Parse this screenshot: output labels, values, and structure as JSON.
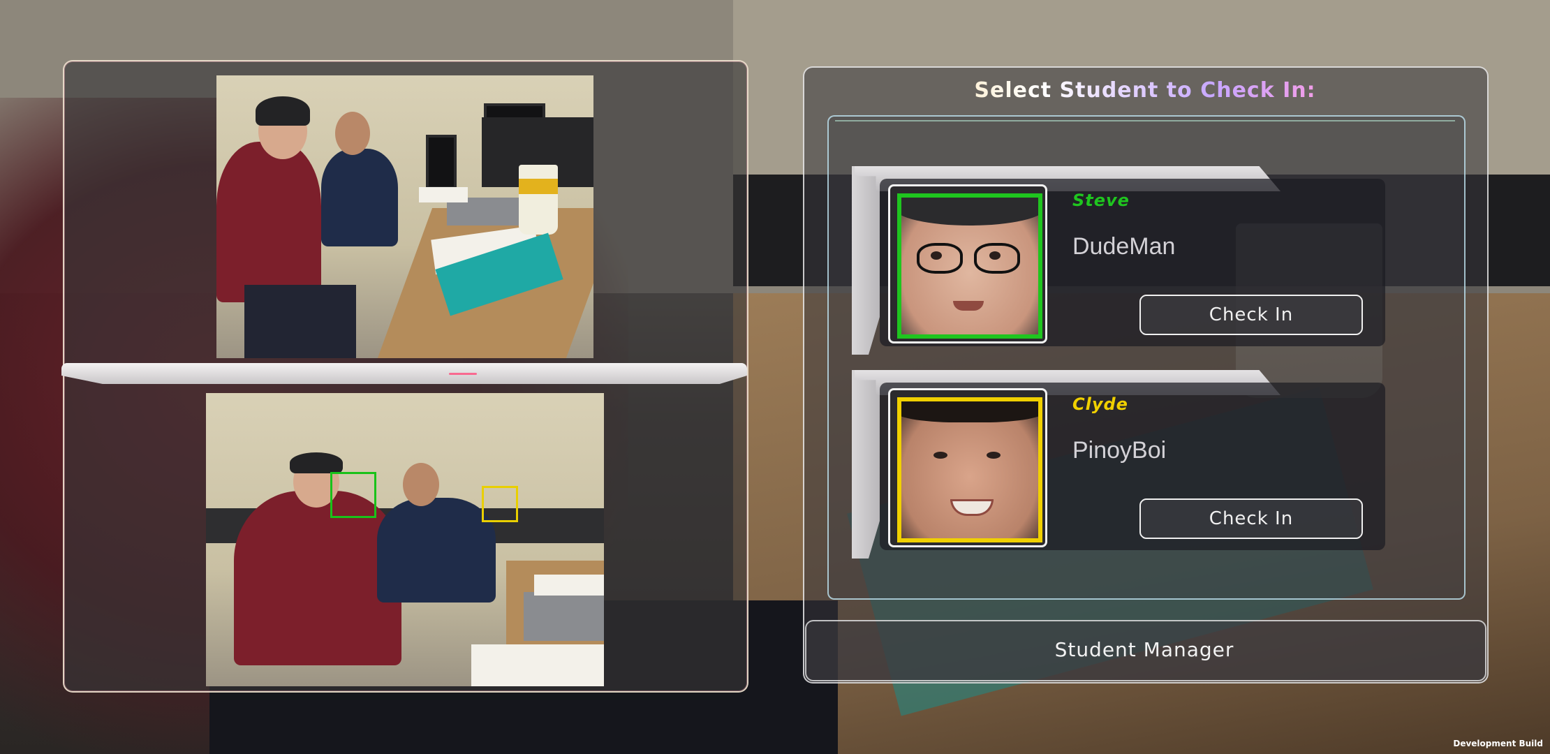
{
  "header": {
    "title": "Select Student to Check In:"
  },
  "students": [
    {
      "name": "Steve",
      "nickname": "DudeMan",
      "button_label": "Check In",
      "accent": "#1fc51f",
      "face_icon": "face-thumbnail"
    },
    {
      "name": "Clyde",
      "nickname": "PinoyBoi",
      "button_label": "Check In",
      "accent": "#f0d000",
      "face_icon": "face-thumbnail"
    }
  ],
  "footer": {
    "label": "Student Manager"
  },
  "build_label": "Development Build",
  "colors": {
    "steve_box": "#1fc51f",
    "clyde_box": "#f0d000",
    "panel_bg": "#343234"
  }
}
